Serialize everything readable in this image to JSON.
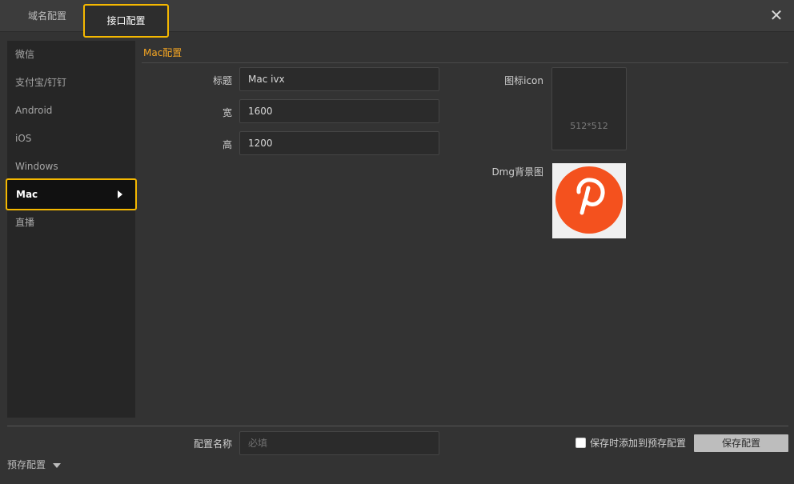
{
  "tabs": {
    "domain_config": "域名配置",
    "api_config": "接口配置"
  },
  "close_icon": "close-icon",
  "sidebar": {
    "items": [
      {
        "label": "微信"
      },
      {
        "label": "支付宝/钉钉"
      },
      {
        "label": "Android"
      },
      {
        "label": "iOS"
      },
      {
        "label": "Windows"
      },
      {
        "label": "Mac",
        "selected": true
      },
      {
        "label": "直播"
      }
    ]
  },
  "section": {
    "title": "Mac配置"
  },
  "form": {
    "title_label": "标题",
    "title_value": "Mac ivx",
    "width_label": "宽",
    "width_value": "1600",
    "height_label": "高",
    "height_value": "1200",
    "icon_label": "图标icon",
    "icon_size": "512*512",
    "dmg_label": "Dmg背景图"
  },
  "footer": {
    "config_name_label": "配置名称",
    "config_name_placeholder": "必填",
    "add_preset_label": "保存时添加到预存配置",
    "save_button": "保存配置",
    "preset_menu": "预存配置"
  },
  "colors": {
    "accent": "#f5b800",
    "section_title": "#f5a623",
    "dmg_circle": "#f4511e"
  }
}
